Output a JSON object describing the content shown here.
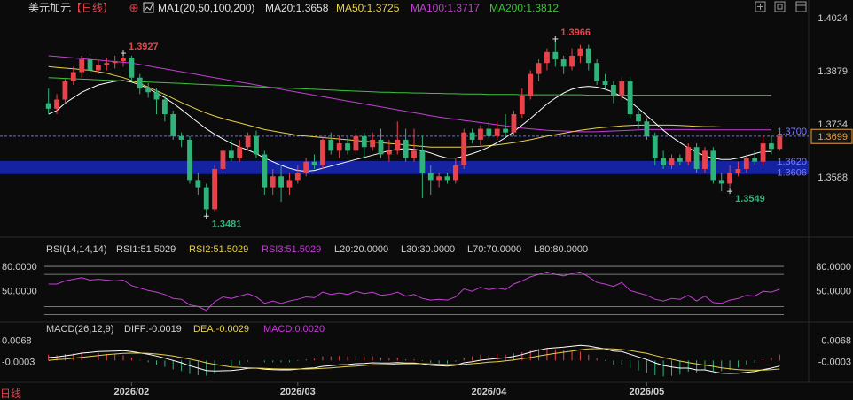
{
  "header": {
    "symbol": "美元加元",
    "period": "【日线】",
    "ma_label": "MA1(20,50,100,200)",
    "ma20": "MA20:1.3658",
    "ma50": "MA50:1.3725",
    "ma100": "MA100:1.3717",
    "ma200": "MA200:1.3812"
  },
  "rsi_header": {
    "label": "RSI(14,14,14)",
    "rsi1": "RSI1:51.5029",
    "rsi2": "RSI2:51.5029",
    "rsi3": "RSI3:51.5029",
    "l20": "L20:20.0000",
    "l30": "L30:30.0000",
    "l70": "L70:70.0000",
    "l80": "L80:80.0000"
  },
  "macd_header": {
    "label": "MACD(26,12,9)",
    "diff": "DIFF:-0.0019",
    "dea": "DEA:-0.0029",
    "macd": "MACD:0.0020"
  },
  "colors": {
    "up": "#e8434b",
    "down": "#2fb37a",
    "ma20": "#ffffff",
    "ma50": "#e8d24a",
    "ma100": "#c43ed6",
    "ma200": "#3cc43c",
    "price_line": "#6a6aff",
    "band": "#1a2bd6",
    "rsi": "#c43ed6"
  },
  "bottom_label": "日线",
  "chart_data": {
    "type": "candlestick",
    "price_axis": {
      "ticks": [
        "1.4024",
        "1.3879",
        "1.3734",
        "1.3588"
      ],
      "range": [
        1.3455,
        1.4024
      ]
    },
    "x_labels": [
      "2026/02",
      "2026/03",
      "2026/04",
      "2026/05"
    ],
    "last_price": "1.3699",
    "price_line_label": "1.3700",
    "band_labels": [
      "1.3620",
      "1.3606"
    ],
    "band_range": [
      1.3596,
      1.3632
    ],
    "annotations": [
      {
        "text": "1.3927",
        "value": 1.3927,
        "index": 9,
        "color": "#e8434b"
      },
      {
        "text": "1.3481",
        "value": 1.3481,
        "index": 19,
        "color": "#2fb37a"
      },
      {
        "text": "1.3966",
        "value": 1.3966,
        "index": 61,
        "color": "#e8434b"
      },
      {
        "text": "1.3549",
        "value": 1.3549,
        "index": 82,
        "color": "#2fb37a"
      }
    ],
    "candles": [
      [
        1.379,
        1.3775,
        1.383,
        1.376
      ],
      [
        1.3775,
        1.38,
        1.3815,
        1.376
      ],
      [
        1.38,
        1.385,
        1.386,
        1.379
      ],
      [
        1.385,
        1.3875,
        1.389,
        1.384
      ],
      [
        1.3875,
        1.391,
        1.392,
        1.386
      ],
      [
        1.391,
        1.388,
        1.3925,
        1.387
      ],
      [
        1.388,
        1.3895,
        1.391,
        1.387
      ],
      [
        1.3895,
        1.39,
        1.3915,
        1.388
      ],
      [
        1.39,
        1.3905,
        1.392,
        1.3885
      ],
      [
        1.3905,
        1.3915,
        1.3927,
        1.389
      ],
      [
        1.3915,
        1.386,
        1.392,
        1.385
      ],
      [
        1.386,
        1.383,
        1.387,
        1.3815
      ],
      [
        1.383,
        1.382,
        1.3845,
        1.3805
      ],
      [
        1.382,
        1.38,
        1.383,
        1.376
      ],
      [
        1.38,
        1.376,
        1.381,
        1.374
      ],
      [
        1.376,
        1.37,
        1.377,
        1.369
      ],
      [
        1.37,
        1.369,
        1.371,
        1.367
      ],
      [
        1.369,
        1.358,
        1.37,
        1.357
      ],
      [
        1.358,
        1.356,
        1.36,
        1.354
      ],
      [
        1.356,
        1.35,
        1.357,
        1.3481
      ],
      [
        1.35,
        1.361,
        1.362,
        1.3495
      ],
      [
        1.361,
        1.366,
        1.368,
        1.36
      ],
      [
        1.366,
        1.364,
        1.369,
        1.363
      ],
      [
        1.364,
        1.367,
        1.369,
        1.363
      ],
      [
        1.367,
        1.37,
        1.371,
        1.366
      ],
      [
        1.37,
        1.365,
        1.3715,
        1.364
      ],
      [
        1.365,
        1.356,
        1.366,
        1.354
      ],
      [
        1.356,
        1.359,
        1.361,
        1.354
      ],
      [
        1.359,
        1.356,
        1.362,
        1.352
      ],
      [
        1.356,
        1.358,
        1.36,
        1.354
      ],
      [
        1.358,
        1.36,
        1.362,
        1.357
      ],
      [
        1.36,
        1.363,
        1.364,
        1.359
      ],
      [
        1.363,
        1.362,
        1.365,
        1.361
      ],
      [
        1.362,
        1.369,
        1.37,
        1.361
      ],
      [
        1.369,
        1.366,
        1.371,
        1.365
      ],
      [
        1.366,
        1.368,
        1.37,
        1.364
      ],
      [
        1.368,
        1.366,
        1.37,
        1.365
      ],
      [
        1.366,
        1.37,
        1.372,
        1.365
      ],
      [
        1.37,
        1.367,
        1.371,
        1.364
      ],
      [
        1.367,
        1.369,
        1.371,
        1.366
      ],
      [
        1.369,
        1.365,
        1.372,
        1.364
      ],
      [
        1.365,
        1.366,
        1.369,
        1.363
      ],
      [
        1.366,
        1.369,
        1.374,
        1.365
      ],
      [
        1.369,
        1.364,
        1.372,
        1.363
      ],
      [
        1.364,
        1.366,
        1.372,
        1.363
      ],
      [
        1.366,
        1.36,
        1.37,
        1.353
      ],
      [
        1.36,
        1.358,
        1.362,
        1.354
      ],
      [
        1.358,
        1.359,
        1.36,
        1.356
      ],
      [
        1.359,
        1.358,
        1.36,
        1.357
      ],
      [
        1.358,
        1.362,
        1.364,
        1.357
      ],
      [
        1.362,
        1.371,
        1.372,
        1.361
      ],
      [
        1.371,
        1.369,
        1.372,
        1.368
      ],
      [
        1.369,
        1.372,
        1.373,
        1.367
      ],
      [
        1.372,
        1.37,
        1.374,
        1.369
      ],
      [
        1.37,
        1.372,
        1.374,
        1.369
      ],
      [
        1.372,
        1.371,
        1.376,
        1.37
      ],
      [
        1.371,
        1.376,
        1.377,
        1.37
      ],
      [
        1.376,
        1.381,
        1.383,
        1.375
      ],
      [
        1.381,
        1.387,
        1.388,
        1.38
      ],
      [
        1.387,
        1.39,
        1.391,
        1.385
      ],
      [
        1.39,
        1.393,
        1.394,
        1.388
      ],
      [
        1.393,
        1.391,
        1.3966,
        1.389
      ],
      [
        1.391,
        1.389,
        1.392,
        1.387
      ],
      [
        1.389,
        1.392,
        1.394,
        1.388
      ],
      [
        1.392,
        1.394,
        1.395,
        1.39
      ],
      [
        1.394,
        1.39,
        1.395,
        1.388
      ],
      [
        1.39,
        1.385,
        1.391,
        1.384
      ],
      [
        1.385,
        1.384,
        1.387,
        1.383
      ],
      [
        1.384,
        1.381,
        1.385,
        1.379
      ],
      [
        1.381,
        1.385,
        1.386,
        1.38
      ],
      [
        1.385,
        1.376,
        1.386,
        1.375
      ],
      [
        1.376,
        1.374,
        1.377,
        1.372
      ],
      [
        1.374,
        1.37,
        1.375,
        1.369
      ],
      [
        1.37,
        1.364,
        1.371,
        1.362
      ],
      [
        1.364,
        1.362,
        1.366,
        1.361
      ],
      [
        1.362,
        1.364,
        1.365,
        1.361
      ],
      [
        1.364,
        1.363,
        1.365,
        1.362
      ],
      [
        1.363,
        1.367,
        1.368,
        1.362
      ],
      [
        1.367,
        1.361,
        1.368,
        1.36
      ],
      [
        1.361,
        1.366,
        1.367,
        1.36
      ],
      [
        1.366,
        1.358,
        1.367,
        1.357
      ],
      [
        1.358,
        1.357,
        1.36,
        1.3549
      ],
      [
        1.357,
        1.36,
        1.362,
        1.356
      ],
      [
        1.36,
        1.361,
        1.363,
        1.359
      ],
      [
        1.361,
        1.364,
        1.365,
        1.36
      ],
      [
        1.364,
        1.363,
        1.366,
        1.362
      ],
      [
        1.363,
        1.368,
        1.37,
        1.362
      ],
      [
        1.368,
        1.3665,
        1.37,
        1.365
      ],
      [
        1.3665,
        1.3699,
        1.371,
        1.366
      ]
    ],
    "ma20": [
      1.376,
      1.377,
      1.379,
      1.3805,
      1.382,
      1.383,
      1.384,
      1.3845,
      1.385,
      1.3852,
      1.3848,
      1.384,
      1.383,
      1.3818,
      1.3805,
      1.379,
      1.3773,
      1.3755,
      1.3737,
      1.372,
      1.3705,
      1.3692,
      1.368,
      1.367,
      1.3662,
      1.3652,
      1.364,
      1.363,
      1.362,
      1.3612,
      1.3606,
      1.3604,
      1.3606,
      1.3612,
      1.3618,
      1.3624,
      1.363,
      1.3636,
      1.3642,
      1.3648,
      1.3654,
      1.366,
      1.3664,
      1.3666,
      1.3664,
      1.366,
      1.3654,
      1.3646,
      1.364,
      1.364,
      1.3645,
      1.3652,
      1.366,
      1.367,
      1.3682,
      1.3696,
      1.3712,
      1.373,
      1.3748,
      1.3768,
      1.3788,
      1.3804,
      1.3818,
      1.3828,
      1.3834,
      1.3836,
      1.3834,
      1.3828,
      1.382,
      1.3808,
      1.3794,
      1.3776,
      1.3756,
      1.3736,
      1.3716,
      1.3698,
      1.3682,
      1.3668,
      1.3656,
      1.3646,
      1.364,
      1.3636,
      1.3636,
      1.364,
      1.3646,
      1.3652,
      1.3658,
      1.3658
    ],
    "ma50": [
      1.389,
      1.3888,
      1.3886,
      1.3884,
      1.3882,
      1.388,
      1.3876,
      1.3872,
      1.3866,
      1.386,
      1.3852,
      1.3844,
      1.3834,
      1.3824,
      1.3814,
      1.3803,
      1.3792,
      1.3782,
      1.3772,
      1.3763,
      1.3755,
      1.3748,
      1.3742,
      1.3736,
      1.373,
      1.3724,
      1.3718,
      1.3714,
      1.371,
      1.3706,
      1.3702,
      1.37,
      1.3698,
      1.3696,
      1.3694,
      1.3692,
      1.369,
      1.3688,
      1.3686,
      1.3684,
      1.3682,
      1.368,
      1.3678,
      1.3676,
      1.3674,
      1.3672,
      1.367,
      1.367,
      1.367,
      1.367,
      1.367,
      1.3671,
      1.3672,
      1.3674,
      1.3676,
      1.3679,
      1.3682,
      1.3686,
      1.369,
      1.3695,
      1.37,
      1.3704,
      1.3708,
      1.3712,
      1.3716,
      1.3719,
      1.3722,
      1.3724,
      1.3726,
      1.3728,
      1.3729,
      1.373,
      1.373,
      1.373,
      1.373,
      1.373,
      1.3729,
      1.3728,
      1.3727,
      1.3726,
      1.3726,
      1.3725,
      1.3725,
      1.3725,
      1.3725,
      1.3725,
      1.3725,
      1.3725
    ],
    "ma100": [
      1.392,
      1.3918,
      1.3916,
      1.3914,
      1.3912,
      1.391,
      1.3908,
      1.3906,
      1.3904,
      1.3902,
      1.39,
      1.3896,
      1.3892,
      1.3888,
      1.3884,
      1.388,
      1.3876,
      1.3872,
      1.3868,
      1.3864,
      1.386,
      1.3856,
      1.3852,
      1.3848,
      1.3844,
      1.384,
      1.3836,
      1.3832,
      1.3828,
      1.3824,
      1.382,
      1.3816,
      1.3812,
      1.3808,
      1.3804,
      1.38,
      1.3796,
      1.3792,
      1.3788,
      1.3784,
      1.378,
      1.3776,
      1.3772,
      1.3768,
      1.3764,
      1.376,
      1.3756,
      1.3752,
      1.3749,
      1.3746,
      1.3743,
      1.374,
      1.3737,
      1.3734,
      1.3731,
      1.3728,
      1.3725,
      1.3722,
      1.372,
      1.3718,
      1.3716,
      1.3715,
      1.3714,
      1.3713,
      1.3712,
      1.3712,
      1.3712,
      1.3713,
      1.3714,
      1.3715,
      1.3716,
      1.3717,
      1.3718,
      1.3718,
      1.3718,
      1.3718,
      1.3718,
      1.3718,
      1.3717,
      1.3717,
      1.3717,
      1.3717,
      1.3717,
      1.3717,
      1.3717,
      1.3717,
      1.3717,
      1.3717
    ],
    "ma200": [
      1.386,
      1.3859,
      1.3858,
      1.3857,
      1.3856,
      1.3855,
      1.3854,
      1.3853,
      1.3852,
      1.3851,
      1.385,
      1.3849,
      1.3848,
      1.3847,
      1.3846,
      1.3845,
      1.3844,
      1.3843,
      1.3842,
      1.3841,
      1.384,
      1.3839,
      1.3838,
      1.3837,
      1.3836,
      1.3835,
      1.3834,
      1.3833,
      1.3832,
      1.3831,
      1.383,
      1.3829,
      1.3828,
      1.3827,
      1.3826,
      1.3825,
      1.3824,
      1.3823,
      1.3822,
      1.3821,
      1.382,
      1.382,
      1.3819,
      1.3819,
      1.3818,
      1.3818,
      1.3817,
      1.3817,
      1.3816,
      1.3816,
      1.3815,
      1.3815,
      1.3815,
      1.3814,
      1.3814,
      1.3814,
      1.3814,
      1.3813,
      1.3813,
      1.3813,
      1.3813,
      1.3813,
      1.3813,
      1.3813,
      1.3813,
      1.3812,
      1.3812,
      1.3812,
      1.3812,
      1.3812,
      1.3812,
      1.3812,
      1.3812,
      1.3812,
      1.3812,
      1.3812,
      1.3812,
      1.3812,
      1.3812,
      1.3812,
      1.3812,
      1.3812,
      1.3812,
      1.3812,
      1.3812,
      1.3812,
      1.3812,
      1.3812
    ],
    "rsi_axis": {
      "ticks": [
        "80.0000",
        "50.0000"
      ],
      "range": [
        15,
        90
      ],
      "levels": [
        20,
        30,
        70,
        80
      ]
    },
    "rsi": [
      58,
      58,
      62,
      64,
      66,
      63,
      64,
      63,
      62,
      63,
      56,
      53,
      50,
      48,
      45,
      40,
      39,
      32,
      30,
      25,
      36,
      42,
      40,
      43,
      46,
      42,
      34,
      37,
      34,
      37,
      39,
      42,
      41,
      48,
      45,
      47,
      45,
      49,
      46,
      48,
      44,
      45,
      48,
      43,
      45,
      40,
      38,
      39,
      38,
      42,
      52,
      49,
      54,
      51,
      53,
      51,
      58,
      62,
      67,
      70,
      73,
      70,
      68,
      71,
      73,
      67,
      60,
      58,
      55,
      60,
      50,
      47,
      44,
      39,
      37,
      40,
      39,
      44,
      37,
      43,
      35,
      34,
      38,
      40,
      44,
      43,
      49,
      48,
      51.5
    ],
    "macd_axis": {
      "ticks": [
        "0.0068",
        "-0.0003"
      ],
      "range": [
        -0.0062,
        0.0082
      ]
    },
    "diff": [
      0.001,
      0.0012,
      0.0016,
      0.002,
      0.0025,
      0.0027,
      0.003,
      0.0031,
      0.0032,
      0.0033,
      0.003,
      0.0026,
      0.0021,
      0.0015,
      0.0008,
      0.0,
      -0.0008,
      -0.0018,
      -0.0026,
      -0.0034,
      -0.0036,
      -0.0035,
      -0.0034,
      -0.0031,
      -0.0027,
      -0.0026,
      -0.003,
      -0.0031,
      -0.0032,
      -0.0032,
      -0.003,
      -0.0027,
      -0.0025,
      -0.002,
      -0.0018,
      -0.0015,
      -0.0014,
      -0.0011,
      -0.001,
      -0.0008,
      -0.0009,
      -0.0009,
      -0.0007,
      -0.0009,
      -0.0009,
      -0.0012,
      -0.0016,
      -0.0018,
      -0.0019,
      -0.0016,
      -0.0008,
      -0.0004,
      0.0001,
      0.0004,
      0.0007,
      0.0009,
      0.0014,
      0.002,
      0.0028,
      0.0035,
      0.0041,
      0.0043,
      0.0045,
      0.0048,
      0.0051,
      0.0049,
      0.0044,
      0.0039,
      0.0032,
      0.003,
      0.0021,
      0.0012,
      0.0003,
      -0.0008,
      -0.0017,
      -0.0022,
      -0.0026,
      -0.0026,
      -0.0032,
      -0.0032,
      -0.0038,
      -0.0043,
      -0.0044,
      -0.0043,
      -0.004,
      -0.0037,
      -0.0031,
      -0.0026,
      -0.0019
    ],
    "dea": [
      0.0,
      0.0003,
      0.0005,
      0.0008,
      0.0011,
      0.0014,
      0.0017,
      0.002,
      0.0022,
      0.0024,
      0.0025,
      0.0025,
      0.0024,
      0.0022,
      0.0019,
      0.0015,
      0.001,
      0.0005,
      -0.0001,
      -0.0008,
      -0.0013,
      -0.0018,
      -0.0022,
      -0.0024,
      -0.0025,
      -0.0026,
      -0.0027,
      -0.0028,
      -0.0029,
      -0.0029,
      -0.0029,
      -0.0029,
      -0.0028,
      -0.0027,
      -0.0025,
      -0.0023,
      -0.0021,
      -0.0019,
      -0.0017,
      -0.0015,
      -0.0014,
      -0.0013,
      -0.0012,
      -0.0011,
      -0.0011,
      -0.0011,
      -0.0012,
      -0.0013,
      -0.0014,
      -0.0014,
      -0.0013,
      -0.0011,
      -0.0009,
      -0.0006,
      -0.0004,
      -0.0001,
      0.0002,
      0.0006,
      0.001,
      0.0015,
      0.002,
      0.0024,
      0.0028,
      0.0032,
      0.0036,
      0.0039,
      0.004,
      0.004,
      0.0039,
      0.0037,
      0.0034,
      0.0029,
      0.0024,
      0.0017,
      0.001,
      0.0004,
      -0.0002,
      -0.0007,
      -0.0012,
      -0.0016,
      -0.002,
      -0.0025,
      -0.0028,
      -0.0031,
      -0.0033,
      -0.0033,
      -0.0033,
      -0.0031,
      -0.0029
    ]
  }
}
